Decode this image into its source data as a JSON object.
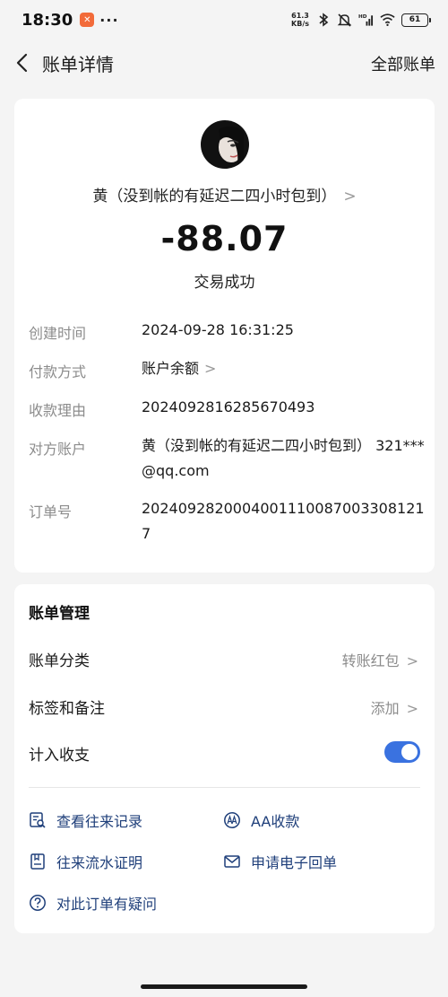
{
  "status_bar": {
    "time": "18:30",
    "dots": "···",
    "net_speed_value": "61.3",
    "net_speed_unit": "KB/s",
    "battery": "61",
    "icons": [
      "bluetooth-icon",
      "mute-icon",
      "hd-signal-icon",
      "wifi-icon",
      "battery-icon"
    ]
  },
  "nav": {
    "title": "账单详情",
    "right_action": "全部账单"
  },
  "transaction": {
    "payee": "黄（没到帐的有延迟二四小时包到）",
    "chevron": ">",
    "amount": "-88.07",
    "status": "交易成功"
  },
  "details": {
    "created_label": "创建时间",
    "created_value": "2024-09-28 16:31:25",
    "payment_label": "付款方式",
    "payment_value": "账户余额",
    "reason_label": "收款理由",
    "reason_value": "2024092816285670493",
    "counterparty_label": "对方账户",
    "counterparty_value": "黄（没到帐的有延迟二四小时包到） 321***@qq.com",
    "order_label": "订单号",
    "order_value": "20240928200040011100870033081217"
  },
  "manage": {
    "title": "账单管理",
    "category_label": "账单分类",
    "category_value": "转账红包",
    "tags_label": "标签和备注",
    "tags_value": "添加",
    "include_label": "计入收支",
    "include_on": true,
    "actions": {
      "history": "查看往来记录",
      "aa": "AA收款",
      "proof": "往来流水证明",
      "receipt": "申请电子回单",
      "question": "对此订单有疑问"
    }
  },
  "colors": {
    "accent": "#3a72e0",
    "action_text": "#1f3f7a",
    "background": "#f4f4f4"
  }
}
